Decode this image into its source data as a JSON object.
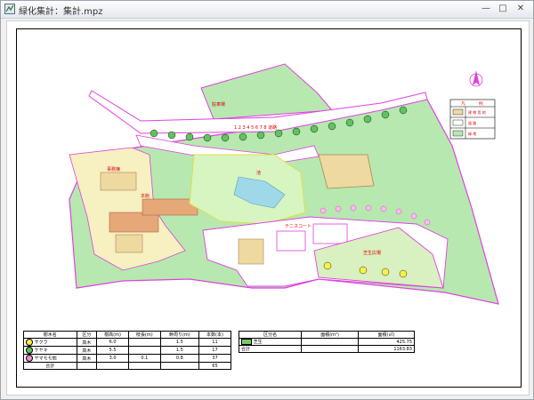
{
  "window": {
    "title": "緑化集計：集計.mpz"
  },
  "map": {
    "labels": [
      "1 2 3 4 5 6 7 8 道路",
      "駐車場",
      "事務棟",
      "本館",
      "池",
      "テニスコート",
      "芝生広場"
    ],
    "legend": {
      "header": [
        "凡",
        "例"
      ],
      "rows": [
        {
          "color": "#eed9a0",
          "label": "建 物 用 地"
        },
        {
          "color": "#ffffff",
          "label": "道 路"
        },
        {
          "color": "#b7e8b0",
          "label": "緑 地"
        }
      ]
    }
  },
  "tree_table": {
    "headers": [
      "樹木名",
      "区分",
      "樹高(m)",
      "枝張(m)",
      "幹周り(m)",
      "本数(本)"
    ],
    "rows": [
      {
        "symbol_color": "#f6f04a",
        "name": "サクラ",
        "type": "高木",
        "height": "6.0",
        "spread": "",
        "girth": "1.5",
        "count": "11"
      },
      {
        "symbol_color": "#5fc45f",
        "name": "ケヤキ",
        "type": "高木",
        "height": "5.5",
        "spread": "",
        "girth": "1.5",
        "count": "17"
      },
      {
        "symbol_color": "#f08fd0",
        "name": "ヤマモモ他",
        "type": "高木",
        "height": "3.0",
        "spread": "0.1",
        "girth": "0.8",
        "count": "37"
      }
    ],
    "total": {
      "label": "合計",
      "count": "65"
    }
  },
  "area_table": {
    "headers": [
      "区分名",
      "面積(m²)",
      "面積(㎡)"
    ],
    "rows": [
      {
        "swatch": "#77c86a",
        "name": "芝生",
        "blank": "",
        "area": "425.75"
      }
    ],
    "total": {
      "label": "合計",
      "area": "1163.83"
    }
  }
}
